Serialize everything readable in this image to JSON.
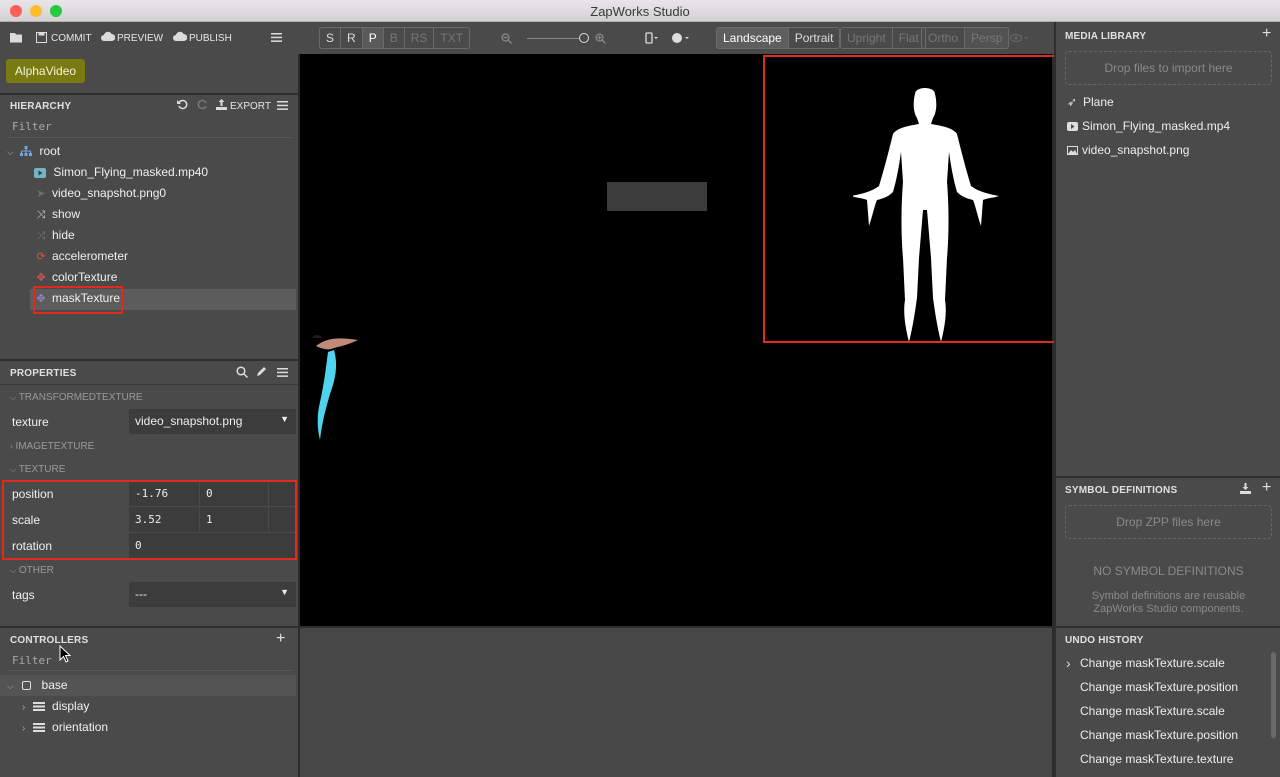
{
  "window": {
    "title": "ZapWorks Studio"
  },
  "toolbar": {
    "commit": "COMMIT",
    "preview": "PREVIEW",
    "publish": "PUBLISH",
    "project_button": "AlphaVideo"
  },
  "view_toolbar": {
    "modes": [
      "S",
      "R",
      "P",
      "B",
      "RS",
      "TXT"
    ],
    "orientation": [
      "Landscape",
      "Portrait"
    ],
    "camera": [
      "Upright",
      "Flat"
    ],
    "projection": [
      "Ortho",
      "Persp"
    ]
  },
  "hierarchy": {
    "title": "HIERARCHY",
    "export": "EXPORT",
    "filter_placeholder": "Filter",
    "items": [
      {
        "label": "root",
        "icon": "hierarchy-icon"
      },
      {
        "label": "Simon_Flying_masked.mp40",
        "icon": "video-icon"
      },
      {
        "label": "video_snapshot.png0",
        "icon": "image-icon"
      },
      {
        "label": "show",
        "icon": "shuffle-icon"
      },
      {
        "label": "hide",
        "icon": "shuffle-icon"
      },
      {
        "label": "accelerometer",
        "icon": "refresh-icon"
      },
      {
        "label": "colorTexture",
        "icon": "move-icon"
      },
      {
        "label": "maskTexture",
        "icon": "move-icon"
      }
    ]
  },
  "properties": {
    "title": "PROPERTIES",
    "sections": {
      "transformed": "TRANSFORMEDTEXTURE",
      "image": "IMAGETEXTURE",
      "texture": "TEXTURE",
      "other": "OTHER"
    },
    "texture_label": "texture",
    "texture_value": "video_snapshot.png",
    "position_label": "position",
    "position_x": "-1.76",
    "position_y": "0",
    "scale_label": "scale",
    "scale_x": "3.52",
    "scale_y": "1",
    "rotation_label": "rotation",
    "rotation_value": "0",
    "tags_label": "tags",
    "tags_value": "---"
  },
  "controllers": {
    "title": "CONTROLLERS",
    "filter_placeholder": "Filter",
    "items": [
      {
        "label": "base"
      },
      {
        "label": "display"
      },
      {
        "label": "orientation"
      }
    ]
  },
  "media_library": {
    "title": "MEDIA LIBRARY",
    "drop_text": "Drop files to import here",
    "items": [
      "Plane",
      "Simon_Flying_masked.mp4",
      "video_snapshot.png"
    ]
  },
  "symbol_definitions": {
    "title": "SYMBOL DEFINITIONS",
    "drop_text": "Drop ZPP files here",
    "empty_title": "NO SYMBOL DEFINITIONS",
    "empty_desc_1": "Symbol definitions are reusable",
    "empty_desc_2": "ZapWorks Studio components."
  },
  "undo_history": {
    "title": "UNDO HISTORY",
    "items": [
      "Change maskTexture.scale",
      "Change maskTexture.position",
      "Change maskTexture.scale",
      "Change maskTexture.position",
      "Change maskTexture.texture"
    ]
  },
  "colors": {
    "project_button": "#7a7a12",
    "highlight": "#e02a1b",
    "selected_row": "#5c5c5c"
  }
}
